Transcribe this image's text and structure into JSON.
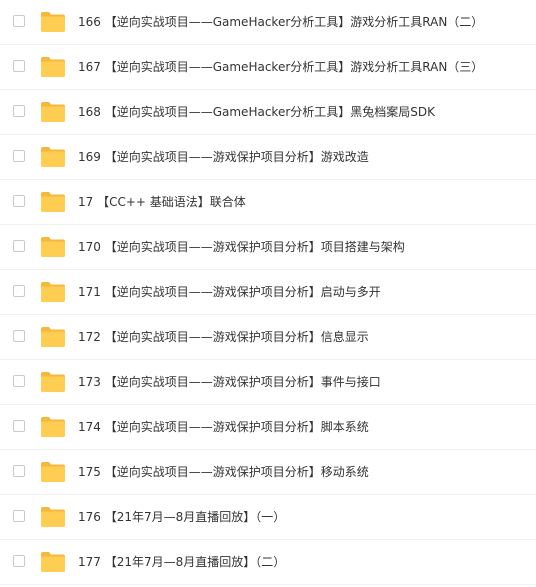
{
  "files": [
    {
      "name": "166 【逆向实战项目——GameHacker分析工具】游戏分析工具RAN（二）",
      "icon": "folder-icon"
    },
    {
      "name": "167 【逆向实战项目——GameHacker分析工具】游戏分析工具RAN（三）",
      "icon": "folder-icon"
    },
    {
      "name": "168 【逆向实战项目——GameHacker分析工具】黑兔档案局SDK",
      "icon": "folder-icon"
    },
    {
      "name": "169 【逆向实战项目——游戏保护项目分析】游戏改造",
      "icon": "folder-icon"
    },
    {
      "name": "17 【CC++ 基础语法】联合体",
      "icon": "folder-icon"
    },
    {
      "name": "170 【逆向实战项目——游戏保护项目分析】项目搭建与架构",
      "icon": "folder-icon"
    },
    {
      "name": "171 【逆向实战项目——游戏保护项目分析】启动与多开",
      "icon": "folder-icon"
    },
    {
      "name": "172 【逆向实战项目——游戏保护项目分析】信息显示",
      "icon": "folder-icon"
    },
    {
      "name": "173 【逆向实战项目——游戏保护项目分析】事件与接口",
      "icon": "folder-icon"
    },
    {
      "name": "174 【逆向实战项目——游戏保护项目分析】脚本系统",
      "icon": "folder-icon"
    },
    {
      "name": "175 【逆向实战项目——游戏保护项目分析】移动系统",
      "icon": "folder-icon"
    },
    {
      "name": "176 【21年7月—8月直播回放】（一）",
      "icon": "folder-icon"
    },
    {
      "name": "177 【21年7月—8月直播回放】（二）",
      "icon": "folder-icon"
    }
  ],
  "colors": {
    "folder_back": "#f5b83d",
    "folder_front": "#ffcd52",
    "text": "#333333",
    "checkbox_border": "#c9c9c9",
    "row_divider": "#f2f2f2"
  }
}
